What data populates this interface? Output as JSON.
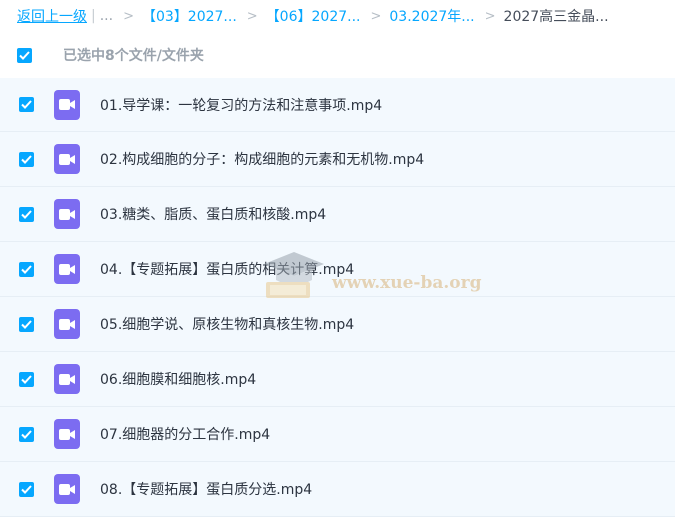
{
  "breadcrumb": {
    "back_label": "返回上一级",
    "separator": "|",
    "ellipsis": "...",
    "chevron": ">",
    "crumbs": [
      "【03】2027...",
      "【06】2027...",
      "03.2027年..."
    ],
    "current": "2027高三金晶..."
  },
  "selection": {
    "label": "已选中8个文件/文件夹"
  },
  "files": [
    {
      "name": "01.导学课：一轮复习的方法和注意事项.mp4"
    },
    {
      "name": "02.构成细胞的分子：构成细胞的元素和无机物.mp4"
    },
    {
      "name": "03.糖类、脂质、蛋白质和核酸.mp4"
    },
    {
      "name": "04.【专题拓展】蛋白质的相关计算.mp4"
    },
    {
      "name": "05.细胞学说、原核生物和真核生物.mp4"
    },
    {
      "name": "06.细胞膜和细胞核.mp4"
    },
    {
      "name": "07.细胞器的分工合作.mp4"
    },
    {
      "name": "08.【专题拓展】蛋白质分选.mp4"
    }
  ],
  "watermark": {
    "text": "www.xue-ba.org"
  },
  "colors": {
    "accent": "#06a7ff",
    "video_icon": "#7c6cf1",
    "row_bg": "#f3f9fe"
  }
}
